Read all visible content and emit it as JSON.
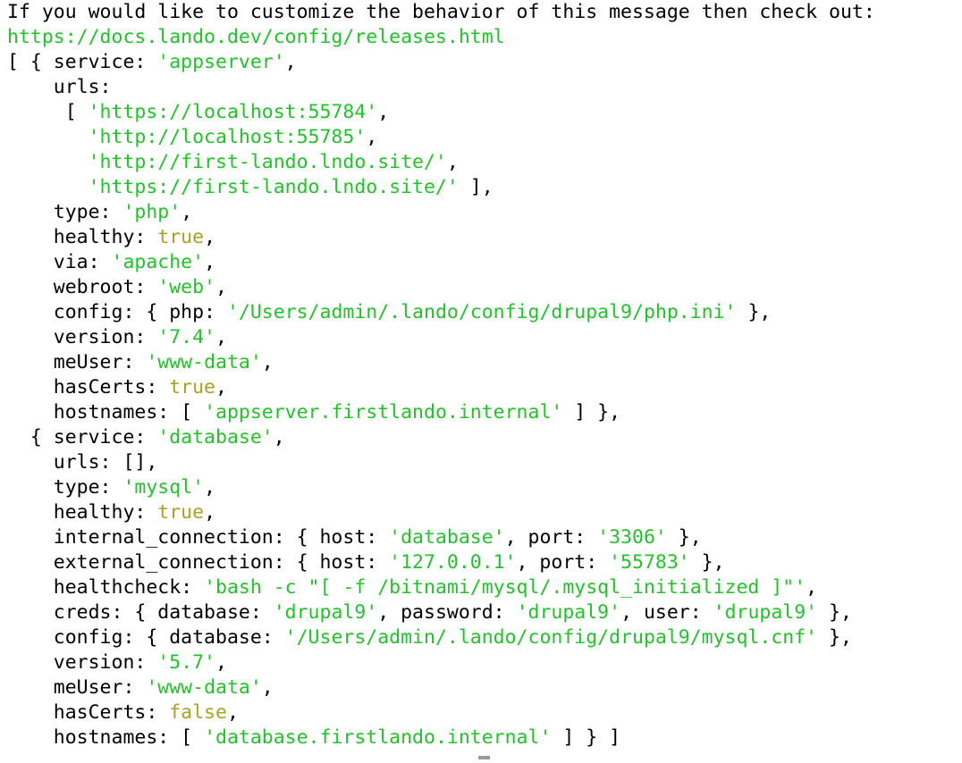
{
  "terminal": {
    "title": "lando start output",
    "background_color": "#ffffff",
    "text_color": "#000000",
    "string_color": "#22c32a",
    "boolean_color": "#a8a125",
    "cursor_color": "#9a9a9a",
    "font_size_px": 21.5,
    "line_height_px": 28,
    "message": "If you would like to customize the behavior of this message then check out:",
    "docs_url": "https://docs.lando.dev/config/releases.html",
    "lines": [
      {
        "id": "l01",
        "tokens": [
          {
            "t": "If you would like to customize the behavior of this message then check out:",
            "c": "plain"
          }
        ]
      },
      {
        "id": "l02",
        "tokens": [
          {
            "t": "https://docs.lando.dev/config/releases.html",
            "c": "url"
          }
        ]
      },
      {
        "id": "l03",
        "tokens": [
          {
            "t": "[ { service: ",
            "c": "plain"
          },
          {
            "t": "'appserver'",
            "c": "str"
          },
          {
            "t": ",",
            "c": "plain"
          }
        ]
      },
      {
        "id": "l04",
        "tokens": [
          {
            "t": "    urls:",
            "c": "plain"
          }
        ]
      },
      {
        "id": "l05",
        "tokens": [
          {
            "t": "     [ ",
            "c": "plain"
          },
          {
            "t": "'https://localhost:55784'",
            "c": "str"
          },
          {
            "t": ",",
            "c": "plain"
          }
        ]
      },
      {
        "id": "l06",
        "tokens": [
          {
            "t": "       ",
            "c": "plain"
          },
          {
            "t": "'http://localhost:55785'",
            "c": "str"
          },
          {
            "t": ",",
            "c": "plain"
          }
        ]
      },
      {
        "id": "l07",
        "tokens": [
          {
            "t": "       ",
            "c": "plain"
          },
          {
            "t": "'http://first-lando.lndo.site/'",
            "c": "str"
          },
          {
            "t": ",",
            "c": "plain"
          }
        ]
      },
      {
        "id": "l08",
        "tokens": [
          {
            "t": "       ",
            "c": "plain"
          },
          {
            "t": "'https://first-lando.lndo.site/'",
            "c": "str"
          },
          {
            "t": " ],",
            "c": "plain"
          }
        ]
      },
      {
        "id": "l09",
        "tokens": [
          {
            "t": "    type: ",
            "c": "plain"
          },
          {
            "t": "'php'",
            "c": "str"
          },
          {
            "t": ",",
            "c": "plain"
          }
        ]
      },
      {
        "id": "l10",
        "tokens": [
          {
            "t": "    healthy: ",
            "c": "plain"
          },
          {
            "t": "true",
            "c": "bool"
          },
          {
            "t": ",",
            "c": "plain"
          }
        ]
      },
      {
        "id": "l11",
        "tokens": [
          {
            "t": "    via: ",
            "c": "plain"
          },
          {
            "t": "'apache'",
            "c": "str"
          },
          {
            "t": ",",
            "c": "plain"
          }
        ]
      },
      {
        "id": "l12",
        "tokens": [
          {
            "t": "    webroot: ",
            "c": "plain"
          },
          {
            "t": "'web'",
            "c": "str"
          },
          {
            "t": ",",
            "c": "plain"
          }
        ]
      },
      {
        "id": "l13",
        "tokens": [
          {
            "t": "    config: { php: ",
            "c": "plain"
          },
          {
            "t": "'/Users/admin/.lando/config/drupal9/php.ini'",
            "c": "str"
          },
          {
            "t": " },",
            "c": "plain"
          }
        ]
      },
      {
        "id": "l14",
        "tokens": [
          {
            "t": "    version: ",
            "c": "plain"
          },
          {
            "t": "'7.4'",
            "c": "str"
          },
          {
            "t": ",",
            "c": "plain"
          }
        ]
      },
      {
        "id": "l15",
        "tokens": [
          {
            "t": "    meUser: ",
            "c": "plain"
          },
          {
            "t": "'www-data'",
            "c": "str"
          },
          {
            "t": ",",
            "c": "plain"
          }
        ]
      },
      {
        "id": "l16",
        "tokens": [
          {
            "t": "    hasCerts: ",
            "c": "plain"
          },
          {
            "t": "true",
            "c": "bool"
          },
          {
            "t": ",",
            "c": "plain"
          }
        ]
      },
      {
        "id": "l17",
        "tokens": [
          {
            "t": "    hostnames: [ ",
            "c": "plain"
          },
          {
            "t": "'appserver.firstlando.internal'",
            "c": "str"
          },
          {
            "t": " ] },",
            "c": "plain"
          }
        ]
      },
      {
        "id": "l18",
        "tokens": [
          {
            "t": "  { service: ",
            "c": "plain"
          },
          {
            "t": "'database'",
            "c": "str"
          },
          {
            "t": ",",
            "c": "plain"
          }
        ]
      },
      {
        "id": "l19",
        "tokens": [
          {
            "t": "    urls: [],",
            "c": "plain"
          }
        ]
      },
      {
        "id": "l20",
        "tokens": [
          {
            "t": "    type: ",
            "c": "plain"
          },
          {
            "t": "'mysql'",
            "c": "str"
          },
          {
            "t": ",",
            "c": "plain"
          }
        ]
      },
      {
        "id": "l21",
        "tokens": [
          {
            "t": "    healthy: ",
            "c": "plain"
          },
          {
            "t": "true",
            "c": "bool"
          },
          {
            "t": ",",
            "c": "plain"
          }
        ]
      },
      {
        "id": "l22",
        "tokens": [
          {
            "t": "    internal_connection: { host: ",
            "c": "plain"
          },
          {
            "t": "'database'",
            "c": "str"
          },
          {
            "t": ", port: ",
            "c": "plain"
          },
          {
            "t": "'3306'",
            "c": "str"
          },
          {
            "t": " },",
            "c": "plain"
          }
        ]
      },
      {
        "id": "l23",
        "tokens": [
          {
            "t": "    external_connection: { host: ",
            "c": "plain"
          },
          {
            "t": "'127.0.0.1'",
            "c": "str"
          },
          {
            "t": ", port: ",
            "c": "plain"
          },
          {
            "t": "'55783'",
            "c": "str"
          },
          {
            "t": " },",
            "c": "plain"
          }
        ]
      },
      {
        "id": "l24",
        "tokens": [
          {
            "t": "    healthcheck: ",
            "c": "plain"
          },
          {
            "t": "'bash -c \"[ -f /bitnami/mysql/.mysql_initialized ]\"'",
            "c": "str"
          },
          {
            "t": ",",
            "c": "plain"
          }
        ]
      },
      {
        "id": "l25",
        "tokens": [
          {
            "t": "    creds: { database: ",
            "c": "plain"
          },
          {
            "t": "'drupal9'",
            "c": "str"
          },
          {
            "t": ", password: ",
            "c": "plain"
          },
          {
            "t": "'drupal9'",
            "c": "str"
          },
          {
            "t": ", user: ",
            "c": "plain"
          },
          {
            "t": "'drupal9'",
            "c": "str"
          },
          {
            "t": " },",
            "c": "plain"
          }
        ]
      },
      {
        "id": "l26",
        "tokens": [
          {
            "t": "    config: { database: ",
            "c": "plain"
          },
          {
            "t": "'/Users/admin/.lando/config/drupal9/mysql.cnf'",
            "c": "str"
          },
          {
            "t": " },",
            "c": "plain"
          }
        ]
      },
      {
        "id": "l27",
        "tokens": [
          {
            "t": "    version: ",
            "c": "plain"
          },
          {
            "t": "'5.7'",
            "c": "str"
          },
          {
            "t": ",",
            "c": "plain"
          }
        ]
      },
      {
        "id": "l28",
        "tokens": [
          {
            "t": "    meUser: ",
            "c": "plain"
          },
          {
            "t": "'www-data'",
            "c": "str"
          },
          {
            "t": ",",
            "c": "plain"
          }
        ]
      },
      {
        "id": "l29",
        "tokens": [
          {
            "t": "    hasCerts: ",
            "c": "plain"
          },
          {
            "t": "false",
            "c": "bool"
          },
          {
            "t": ",",
            "c": "plain"
          }
        ]
      },
      {
        "id": "l30",
        "tokens": [
          {
            "t": "    hostnames: [ ",
            "c": "plain"
          },
          {
            "t": "'database.firstlando.internal'",
            "c": "str"
          },
          {
            "t": " ] } ]",
            "c": "plain"
          }
        ]
      }
    ],
    "services": [
      {
        "service": "appserver",
        "urls": [
          "https://localhost:55784",
          "http://localhost:55785",
          "http://first-lando.lndo.site/",
          "https://first-lando.lndo.site/"
        ],
        "type": "php",
        "healthy": "true",
        "via": "apache",
        "webroot": "web",
        "config": {
          "php": "/Users/admin/.lando/config/drupal9/php.ini"
        },
        "version": "7.4",
        "meUser": "www-data",
        "hasCerts": "true",
        "hostnames": [
          "appserver.firstlando.internal"
        ]
      },
      {
        "service": "database",
        "urls": [],
        "type": "mysql",
        "healthy": "true",
        "internal_connection": {
          "host": "database",
          "port": "3306"
        },
        "external_connection": {
          "host": "127.0.0.1",
          "port": "55783"
        },
        "healthcheck": "bash -c \"[ -f /bitnami/mysql/.mysql_initialized ]\"",
        "creds": {
          "database": "drupal9",
          "password": "drupal9",
          "user": "drupal9"
        },
        "config": {
          "database": "/Users/admin/.lando/config/drupal9/mysql.cnf"
        },
        "version": "5.7",
        "meUser": "www-data",
        "hasCerts": "false",
        "hostnames": [
          "database.firstlando.internal"
        ]
      }
    ]
  }
}
